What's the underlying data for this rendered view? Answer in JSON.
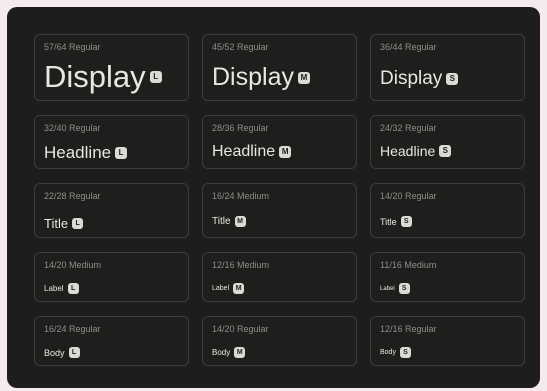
{
  "colors": {
    "page_background": "#f5eaec",
    "panel_background": "#1d1e1c",
    "card_border": "#3b3d3a",
    "spec_text": "#8c8e8a",
    "sample_text": "#e6e6e2",
    "badge_background": "#d9dbd5"
  },
  "rows": [
    {
      "cells": [
        {
          "spec": "57/64 Regular",
          "label": "Display",
          "size": "L"
        },
        {
          "spec": "45/52 Regular",
          "label": "Display",
          "size": "M"
        },
        {
          "spec": "36/44 Regular",
          "label": "Display",
          "size": "S"
        }
      ]
    },
    {
      "cells": [
        {
          "spec": "32/40 Regular",
          "label": "Headline",
          "size": "L"
        },
        {
          "spec": "28/36 Regular",
          "label": "Headline",
          "size": "M"
        },
        {
          "spec": "24/32 Regular",
          "label": "Headline",
          "size": "S"
        }
      ]
    },
    {
      "cells": [
        {
          "spec": "22/28 Regular",
          "label": "Title",
          "size": "L"
        },
        {
          "spec": "16/24 Medium",
          "label": "Title",
          "size": "M"
        },
        {
          "spec": "14/20 Regular",
          "label": "Title",
          "size": "S"
        }
      ]
    },
    {
      "cells": [
        {
          "spec": "14/20 Medium",
          "label": "Label",
          "size": "L"
        },
        {
          "spec": "12/16 Medium",
          "label": "Label",
          "size": "M"
        },
        {
          "spec": "11/16 Medium",
          "label": "Label",
          "size": "S"
        }
      ]
    },
    {
      "cells": [
        {
          "spec": "16/24 Regular",
          "label": "Body",
          "size": "L"
        },
        {
          "spec": "14/20 Regular",
          "label": "Body",
          "size": "M"
        },
        {
          "spec": "12/16 Regular",
          "label": "Body",
          "size": "S"
        }
      ]
    }
  ]
}
